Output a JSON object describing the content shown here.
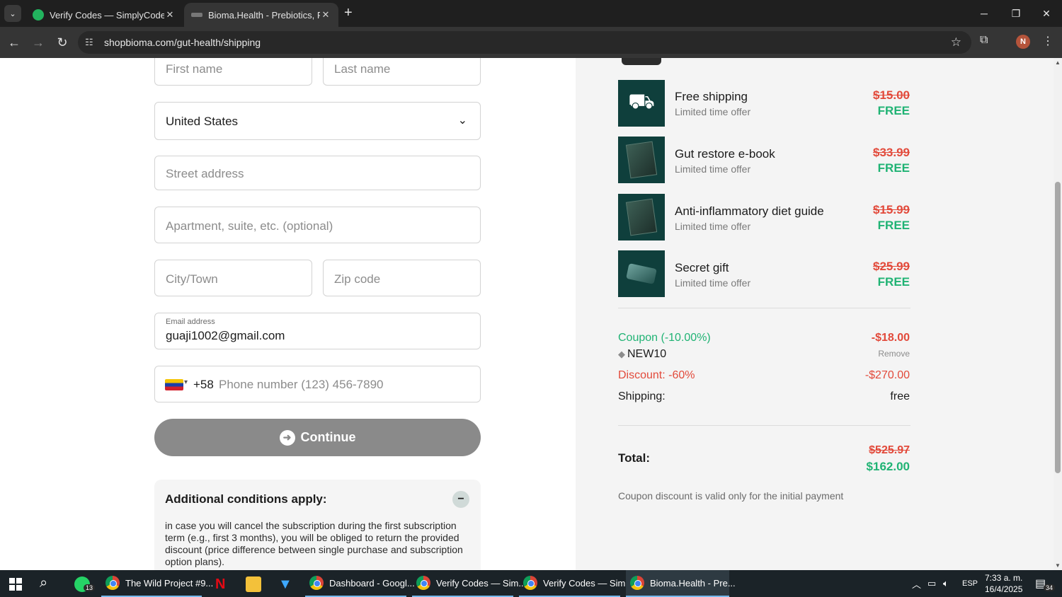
{
  "browser": {
    "tabs": [
      {
        "title": "Verify Codes — SimplyCodes",
        "active": false
      },
      {
        "title": "Bioma.Health - Prebiotics, Prob",
        "active": true
      }
    ],
    "url": "shopbioma.com/gut-health/shipping"
  },
  "form": {
    "first_name_placeholder": "First name",
    "last_name_placeholder": "Last name",
    "country": "United States",
    "street_placeholder": "Street address",
    "apartment_placeholder": "Apartment, suite, etc. (optional)",
    "city_placeholder": "City/Town",
    "zip_placeholder": "Zip code",
    "email_label": "Email address",
    "email_value": "guaji1002@gmail.com",
    "dial_code": "+58",
    "phone_placeholder": "Phone number (123) 456-7890",
    "continue_label": "Continue"
  },
  "conditions": {
    "title": "Additional conditions apply:",
    "body": "in case you will cancel the subscription during the first subscription term (e.g., first 3 months), you will be obliged to return the provided discount (price difference between single purchase and subscription option plans)."
  },
  "summary": {
    "items": [
      {
        "name": "Free shipping",
        "sub": "Limited time offer",
        "old_price": "$15.00",
        "price": "FREE",
        "icon": "truck-icon"
      },
      {
        "name": "Gut restore e-book",
        "sub": "Limited time offer",
        "old_price": "$33.99",
        "price": "FREE",
        "icon": "book-icon"
      },
      {
        "name": "Anti-inflammatory diet guide",
        "sub": "Limited time offer",
        "old_price": "$15.99",
        "price": "FREE",
        "icon": "book-icon"
      },
      {
        "name": "Secret gift",
        "sub": "Limited time offer",
        "old_price": "$25.99",
        "price": "FREE",
        "icon": "gift-icon"
      }
    ],
    "coupon_label": "Coupon (-10.00%)",
    "coupon_amount": "-$18.00",
    "coupon_code": "NEW10",
    "remove_label": "Remove",
    "discount_label": "Discount: -60%",
    "discount_amount": "-$270.00",
    "shipping_label": "Shipping:",
    "shipping_value": "free",
    "total_label": "Total:",
    "total_old": "$525.97",
    "total_new": "$162.00",
    "coupon_note": "Coupon discount is valid only for the initial payment"
  },
  "taskbar": {
    "apps": [
      {
        "label": "The Wild Project #9..."
      },
      {
        "label": "Dashboard - Googl..."
      },
      {
        "label": "Verify Codes — Sim..."
      },
      {
        "label": "Verify Codes — Sim..."
      },
      {
        "label": "Bioma.Health - Pre..."
      }
    ],
    "whatsapp_badge": "13",
    "notif_badge": "34",
    "lang": "ESP",
    "time": "7:33 a. m.",
    "date": "16/4/2025"
  },
  "colors": {
    "accent_green": "#20b374",
    "accent_red": "#e24a3b",
    "button_gray": "#8a8a8a"
  }
}
